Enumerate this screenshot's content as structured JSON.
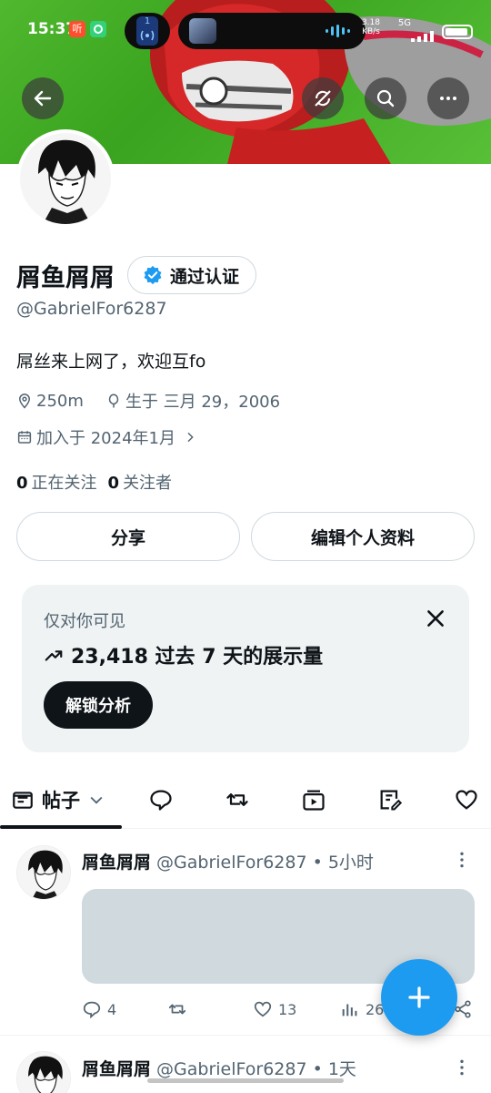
{
  "status_bar": {
    "time": "15:37",
    "app_badge": "听",
    "network_speed": "3.18\nKB/s",
    "network_type": "5G",
    "island_badge": "1"
  },
  "profile": {
    "name": "屑鱼屑屑",
    "verified_label": "通过认证",
    "handle": "@GabrielFor6287",
    "bio": "屌丝来上网了，欢迎互fo",
    "location": "250m",
    "birthday": "生于 三月 29，2006",
    "joined": "加入于 2024年1月",
    "following_count": "0",
    "following_label": "正在关注",
    "followers_count": "0",
    "followers_label": "关注者"
  },
  "buttons": {
    "share": "分享",
    "edit_profile": "编辑个人资料"
  },
  "insight_card": {
    "title": "仅对你可见",
    "stat": "23,418 过去 7 天的展示量",
    "cta": "解锁分析"
  },
  "tabs": {
    "active_label": "帖子",
    "items": [
      "posts",
      "replies",
      "reposts",
      "highlights",
      "articles",
      "likes"
    ]
  },
  "posts": [
    {
      "name": "屑鱼屑屑",
      "meta": "@GabrielFor6287 • 5小时",
      "replies": "4",
      "likes": "13",
      "views": "26"
    },
    {
      "name": "屑鱼屑屑",
      "meta": "@GabrielFor6287 • 1天"
    }
  ],
  "colors": {
    "accent": "#1d9bf0",
    "text_primary": "#0f1419",
    "text_secondary": "#536471",
    "border": "#cfd9de",
    "card_bg": "#eff3f4",
    "banner_green": "#4fb82e"
  },
  "icons": [
    "back-arrow-icon",
    "sync-slash-icon",
    "search-icon",
    "more-icon",
    "verified-badge-icon",
    "location-icon",
    "balloon-icon",
    "calendar-icon",
    "chevron-right-icon",
    "close-icon",
    "trend-up-icon",
    "posts-tab-icon",
    "chevron-down-icon",
    "reply-icon",
    "repost-icon",
    "highlight-icon",
    "article-icon",
    "heart-icon",
    "views-icon",
    "share-icon",
    "plus-icon"
  ]
}
